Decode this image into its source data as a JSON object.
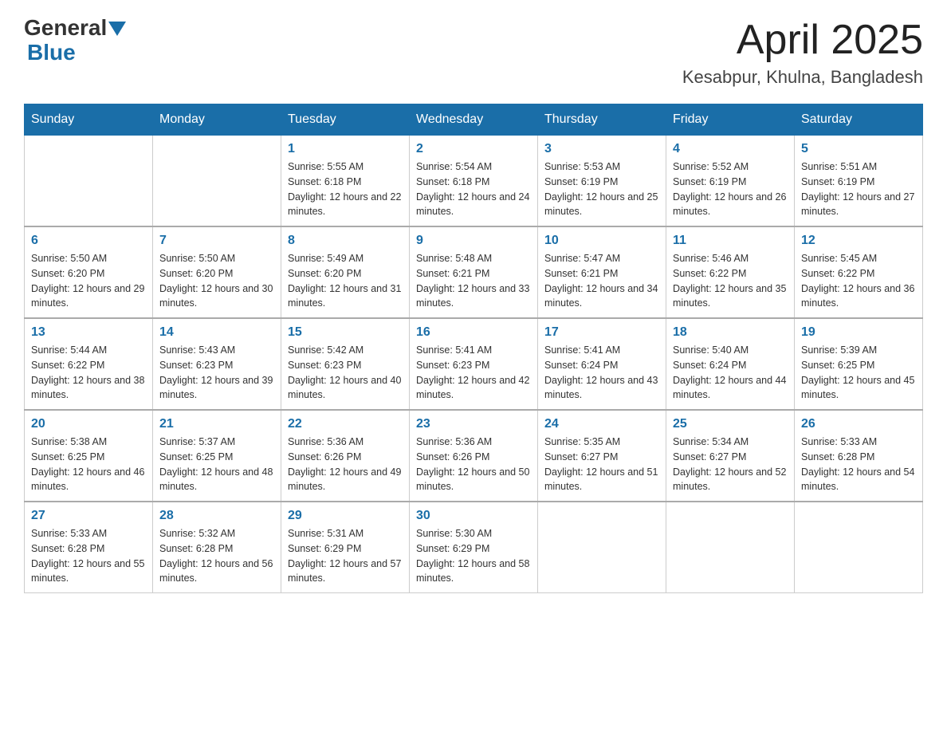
{
  "header": {
    "logo_general": "General",
    "logo_blue": "Blue",
    "month_title": "April 2025",
    "location": "Kesabpur, Khulna, Bangladesh"
  },
  "weekdays": [
    "Sunday",
    "Monday",
    "Tuesday",
    "Wednesday",
    "Thursday",
    "Friday",
    "Saturday"
  ],
  "weeks": [
    [
      {
        "day": "",
        "sunrise": "",
        "sunset": "",
        "daylight": ""
      },
      {
        "day": "",
        "sunrise": "",
        "sunset": "",
        "daylight": ""
      },
      {
        "day": "1",
        "sunrise": "Sunrise: 5:55 AM",
        "sunset": "Sunset: 6:18 PM",
        "daylight": "Daylight: 12 hours and 22 minutes."
      },
      {
        "day": "2",
        "sunrise": "Sunrise: 5:54 AM",
        "sunset": "Sunset: 6:18 PM",
        "daylight": "Daylight: 12 hours and 24 minutes."
      },
      {
        "day": "3",
        "sunrise": "Sunrise: 5:53 AM",
        "sunset": "Sunset: 6:19 PM",
        "daylight": "Daylight: 12 hours and 25 minutes."
      },
      {
        "day": "4",
        "sunrise": "Sunrise: 5:52 AM",
        "sunset": "Sunset: 6:19 PM",
        "daylight": "Daylight: 12 hours and 26 minutes."
      },
      {
        "day": "5",
        "sunrise": "Sunrise: 5:51 AM",
        "sunset": "Sunset: 6:19 PM",
        "daylight": "Daylight: 12 hours and 27 minutes."
      }
    ],
    [
      {
        "day": "6",
        "sunrise": "Sunrise: 5:50 AM",
        "sunset": "Sunset: 6:20 PM",
        "daylight": "Daylight: 12 hours and 29 minutes."
      },
      {
        "day": "7",
        "sunrise": "Sunrise: 5:50 AM",
        "sunset": "Sunset: 6:20 PM",
        "daylight": "Daylight: 12 hours and 30 minutes."
      },
      {
        "day": "8",
        "sunrise": "Sunrise: 5:49 AM",
        "sunset": "Sunset: 6:20 PM",
        "daylight": "Daylight: 12 hours and 31 minutes."
      },
      {
        "day": "9",
        "sunrise": "Sunrise: 5:48 AM",
        "sunset": "Sunset: 6:21 PM",
        "daylight": "Daylight: 12 hours and 33 minutes."
      },
      {
        "day": "10",
        "sunrise": "Sunrise: 5:47 AM",
        "sunset": "Sunset: 6:21 PM",
        "daylight": "Daylight: 12 hours and 34 minutes."
      },
      {
        "day": "11",
        "sunrise": "Sunrise: 5:46 AM",
        "sunset": "Sunset: 6:22 PM",
        "daylight": "Daylight: 12 hours and 35 minutes."
      },
      {
        "day": "12",
        "sunrise": "Sunrise: 5:45 AM",
        "sunset": "Sunset: 6:22 PM",
        "daylight": "Daylight: 12 hours and 36 minutes."
      }
    ],
    [
      {
        "day": "13",
        "sunrise": "Sunrise: 5:44 AM",
        "sunset": "Sunset: 6:22 PM",
        "daylight": "Daylight: 12 hours and 38 minutes."
      },
      {
        "day": "14",
        "sunrise": "Sunrise: 5:43 AM",
        "sunset": "Sunset: 6:23 PM",
        "daylight": "Daylight: 12 hours and 39 minutes."
      },
      {
        "day": "15",
        "sunrise": "Sunrise: 5:42 AM",
        "sunset": "Sunset: 6:23 PM",
        "daylight": "Daylight: 12 hours and 40 minutes."
      },
      {
        "day": "16",
        "sunrise": "Sunrise: 5:41 AM",
        "sunset": "Sunset: 6:23 PM",
        "daylight": "Daylight: 12 hours and 42 minutes."
      },
      {
        "day": "17",
        "sunrise": "Sunrise: 5:41 AM",
        "sunset": "Sunset: 6:24 PM",
        "daylight": "Daylight: 12 hours and 43 minutes."
      },
      {
        "day": "18",
        "sunrise": "Sunrise: 5:40 AM",
        "sunset": "Sunset: 6:24 PM",
        "daylight": "Daylight: 12 hours and 44 minutes."
      },
      {
        "day": "19",
        "sunrise": "Sunrise: 5:39 AM",
        "sunset": "Sunset: 6:25 PM",
        "daylight": "Daylight: 12 hours and 45 minutes."
      }
    ],
    [
      {
        "day": "20",
        "sunrise": "Sunrise: 5:38 AM",
        "sunset": "Sunset: 6:25 PM",
        "daylight": "Daylight: 12 hours and 46 minutes."
      },
      {
        "day": "21",
        "sunrise": "Sunrise: 5:37 AM",
        "sunset": "Sunset: 6:25 PM",
        "daylight": "Daylight: 12 hours and 48 minutes."
      },
      {
        "day": "22",
        "sunrise": "Sunrise: 5:36 AM",
        "sunset": "Sunset: 6:26 PM",
        "daylight": "Daylight: 12 hours and 49 minutes."
      },
      {
        "day": "23",
        "sunrise": "Sunrise: 5:36 AM",
        "sunset": "Sunset: 6:26 PM",
        "daylight": "Daylight: 12 hours and 50 minutes."
      },
      {
        "day": "24",
        "sunrise": "Sunrise: 5:35 AM",
        "sunset": "Sunset: 6:27 PM",
        "daylight": "Daylight: 12 hours and 51 minutes."
      },
      {
        "day": "25",
        "sunrise": "Sunrise: 5:34 AM",
        "sunset": "Sunset: 6:27 PM",
        "daylight": "Daylight: 12 hours and 52 minutes."
      },
      {
        "day": "26",
        "sunrise": "Sunrise: 5:33 AM",
        "sunset": "Sunset: 6:28 PM",
        "daylight": "Daylight: 12 hours and 54 minutes."
      }
    ],
    [
      {
        "day": "27",
        "sunrise": "Sunrise: 5:33 AM",
        "sunset": "Sunset: 6:28 PM",
        "daylight": "Daylight: 12 hours and 55 minutes."
      },
      {
        "day": "28",
        "sunrise": "Sunrise: 5:32 AM",
        "sunset": "Sunset: 6:28 PM",
        "daylight": "Daylight: 12 hours and 56 minutes."
      },
      {
        "day": "29",
        "sunrise": "Sunrise: 5:31 AM",
        "sunset": "Sunset: 6:29 PM",
        "daylight": "Daylight: 12 hours and 57 minutes."
      },
      {
        "day": "30",
        "sunrise": "Sunrise: 5:30 AM",
        "sunset": "Sunset: 6:29 PM",
        "daylight": "Daylight: 12 hours and 58 minutes."
      },
      {
        "day": "",
        "sunrise": "",
        "sunset": "",
        "daylight": ""
      },
      {
        "day": "",
        "sunrise": "",
        "sunset": "",
        "daylight": ""
      },
      {
        "day": "",
        "sunrise": "",
        "sunset": "",
        "daylight": ""
      }
    ]
  ]
}
